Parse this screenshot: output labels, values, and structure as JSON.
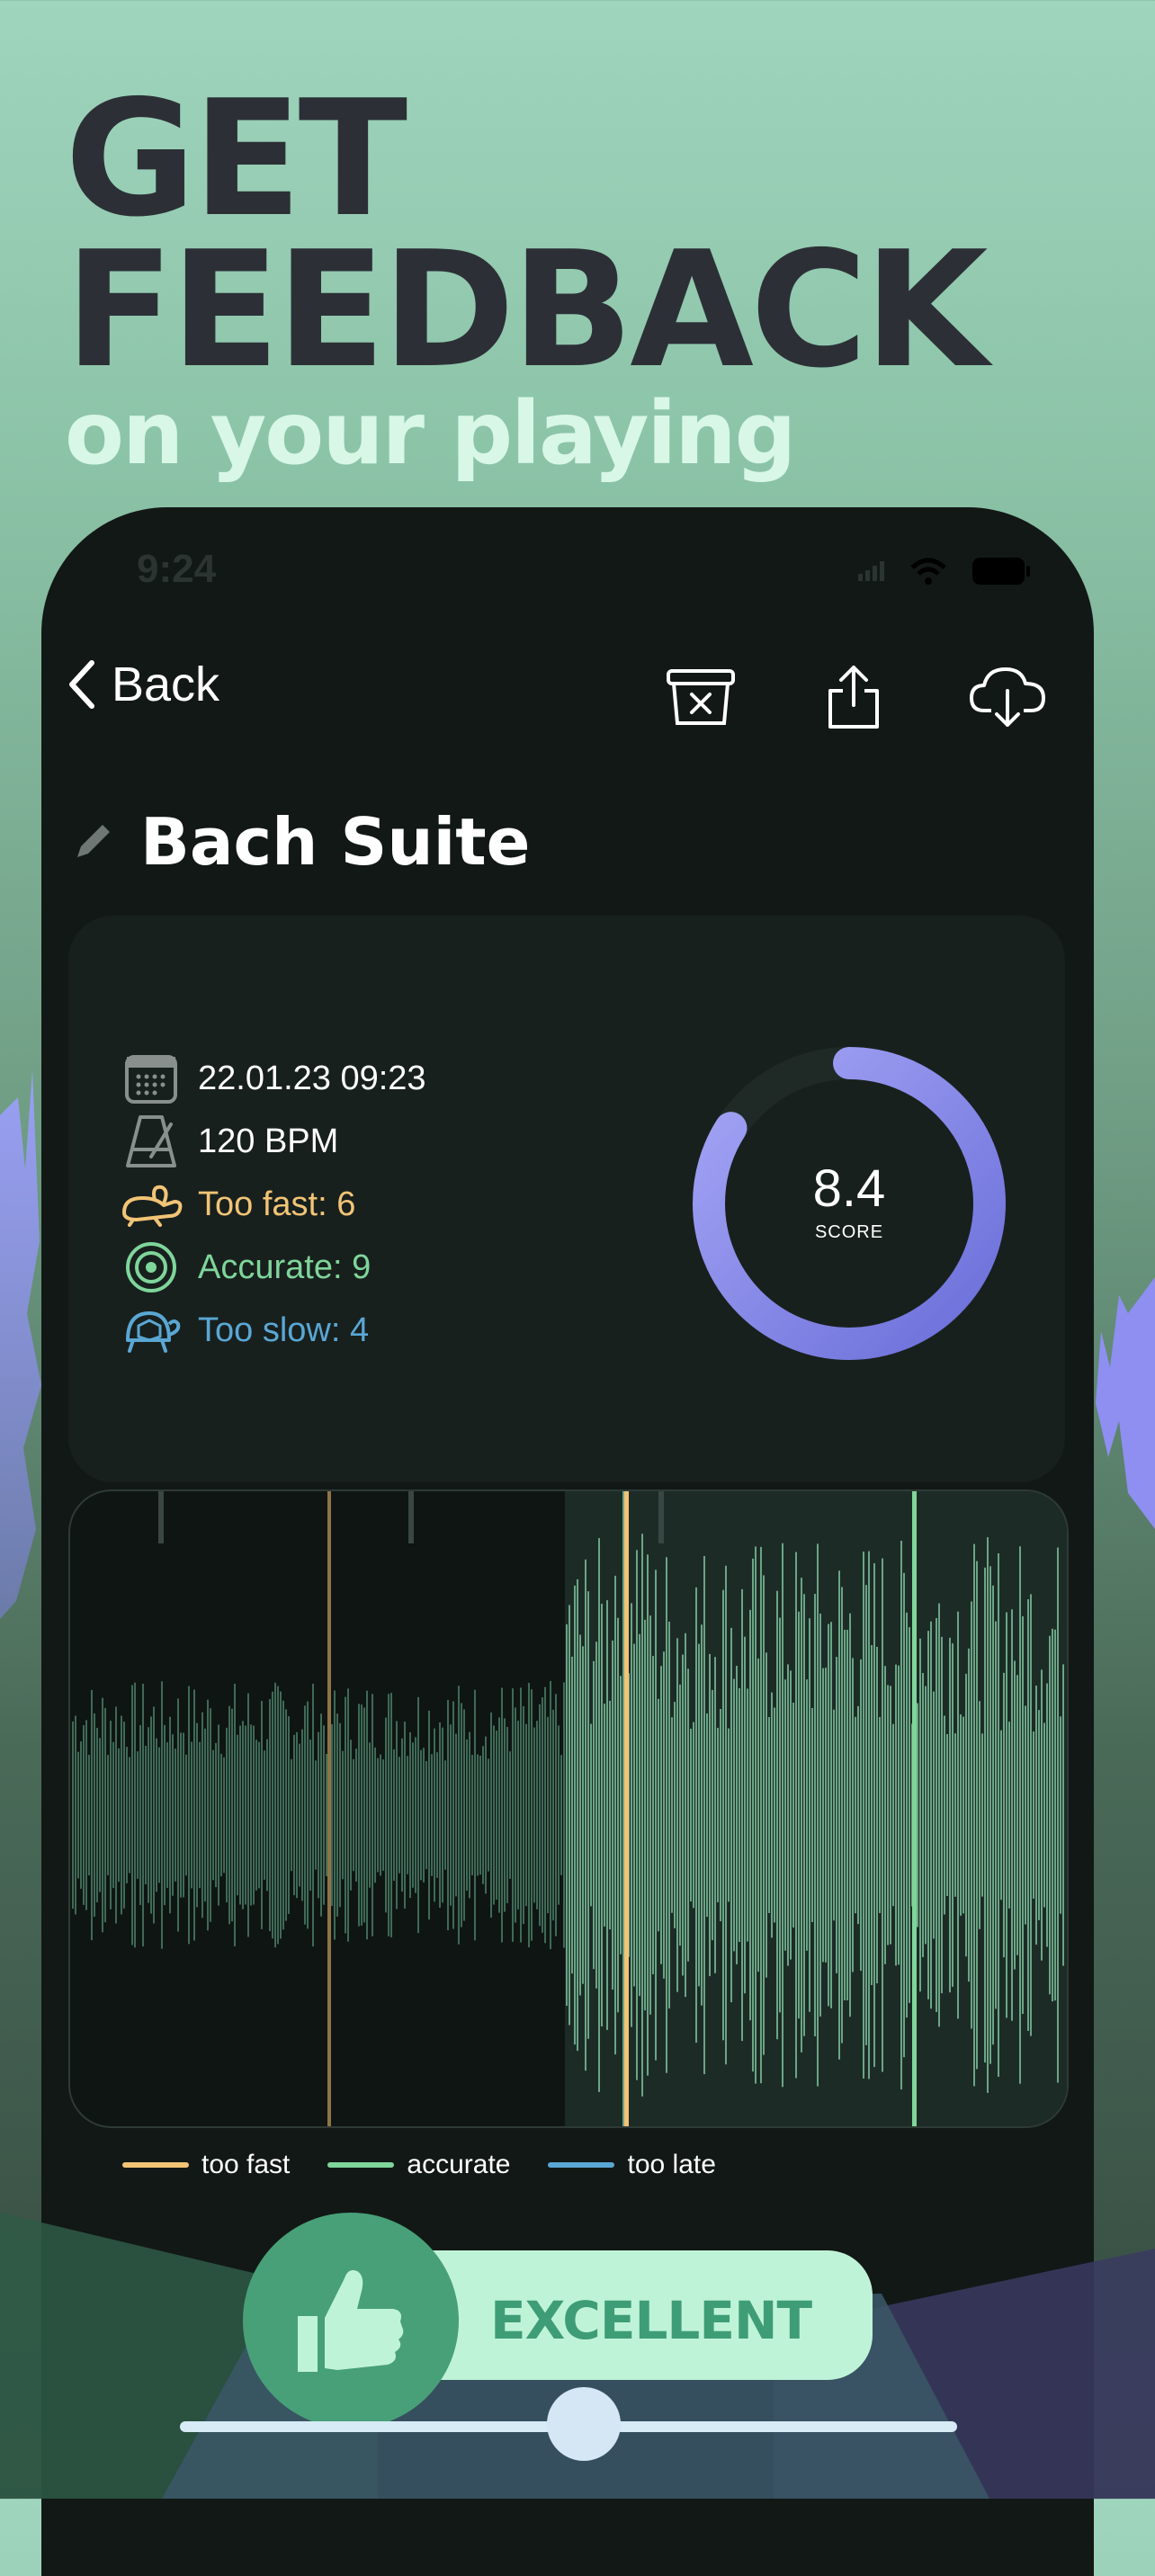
{
  "hero": {
    "line1": "GET",
    "line2": "FEEDBACK",
    "line3": "on your playing"
  },
  "status_bar": {
    "time": "9:24"
  },
  "nav": {
    "back_label": "Back",
    "icons": [
      "delete-icon",
      "share-icon",
      "cloud-download-icon"
    ]
  },
  "recording": {
    "title": "Bach Suite",
    "date": "22.01.23 09:23",
    "tempo": "120 BPM",
    "too_fast": "Too fast: 6",
    "accurate": "Accurate: 9",
    "too_slow": "Too slow: 4",
    "score_value": "8.4",
    "score_label": "SCORE",
    "score_fraction": 0.84
  },
  "legend": {
    "too_fast": "too fast",
    "accurate": "accurate",
    "too_late": "too late"
  },
  "colors": {
    "too_fast": "#f2c476",
    "accurate": "#7fd59a",
    "too_late": "#5aa7d4",
    "score_ring": "#8e8ff0",
    "wave": "#5f9c7b"
  },
  "feedback": {
    "label": "EXCELLENT",
    "slider_value": 0.52
  }
}
